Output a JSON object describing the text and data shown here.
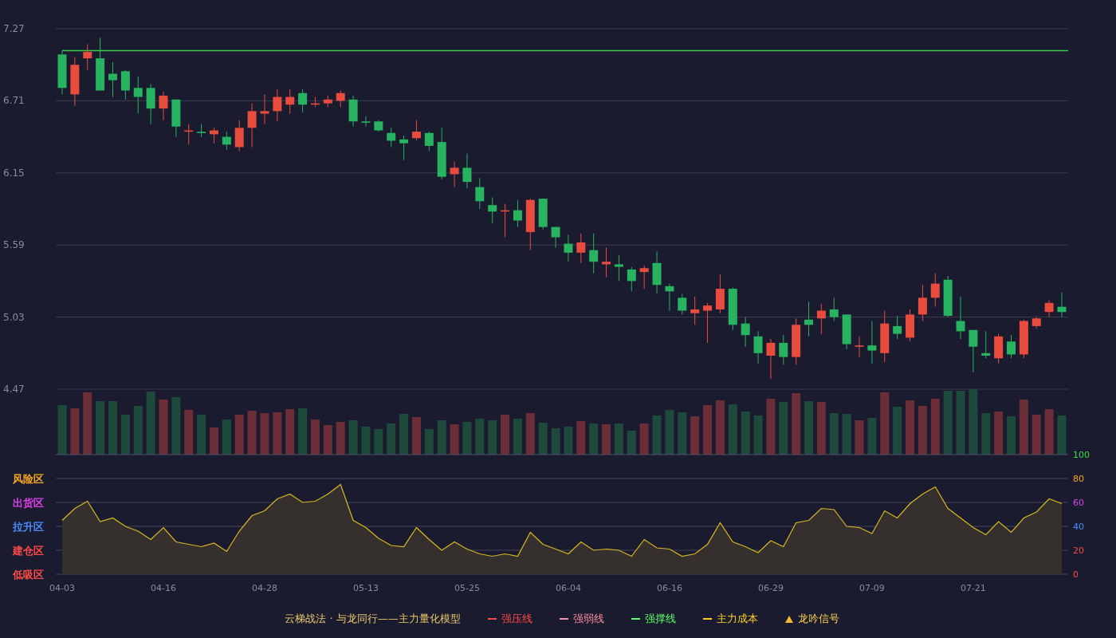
{
  "price_chart": {
    "chart_data": {
      "type": "candlestick",
      "ylim": [
        4.47,
        7.27
      ],
      "grid": true,
      "categories": [
        null,
        null,
        null,
        null,
        null,
        null,
        null,
        null,
        null,
        null,
        null,
        null,
        null,
        null,
        null,
        null,
        null,
        null,
        null,
        null,
        null,
        null,
        null,
        null,
        null,
        null,
        null,
        null,
        null,
        null,
        null,
        null,
        null,
        null,
        null,
        null,
        null,
        null,
        null,
        null,
        null,
        null,
        null,
        null,
        null,
        null,
        null,
        null,
        null,
        null,
        null,
        null,
        null,
        null,
        null,
        null,
        null,
        null,
        null,
        null,
        null,
        null,
        null,
        null,
        null,
        null,
        null,
        null,
        null,
        null,
        null,
        null,
        null,
        null,
        null,
        null,
        null,
        null,
        null,
        null
      ],
      "yticks": [
        {
          "value": 7.27,
          "label": "7.27"
        },
        {
          "value": 6.71,
          "label": "6.71"
        },
        {
          "value": 6.15,
          "label": "6.15"
        },
        {
          "value": 5.59,
          "label": "5.59"
        },
        {
          "value": 5.03,
          "label": "5.03"
        },
        {
          "value": 4.47,
          "label": "4.47"
        }
      ],
      "ohlc": [
        [
          7.07,
          7.1,
          6.76,
          6.81
        ],
        [
          6.76,
          7.05,
          6.67,
          6.99
        ],
        [
          7.04,
          7.15,
          6.95,
          7.09
        ],
        [
          7.04,
          7.2,
          6.79,
          6.79
        ],
        [
          6.92,
          7.01,
          6.74,
          6.87
        ],
        [
          6.94,
          6.95,
          6.72,
          6.79
        ],
        [
          6.81,
          6.9,
          6.61,
          6.74
        ],
        [
          6.81,
          6.84,
          6.53,
          6.65
        ],
        [
          6.65,
          6.78,
          6.56,
          6.75
        ],
        [
          6.72,
          6.72,
          6.43,
          6.51
        ],
        [
          6.47,
          6.53,
          6.37,
          6.48
        ],
        [
          6.47,
          6.53,
          6.43,
          6.46
        ],
        [
          6.45,
          6.5,
          6.38,
          6.48
        ],
        [
          6.43,
          6.47,
          6.33,
          6.37
        ],
        [
          6.35,
          6.56,
          6.32,
          6.5
        ],
        [
          6.5,
          6.69,
          6.35,
          6.63
        ],
        [
          6.61,
          6.76,
          6.53,
          6.63
        ],
        [
          6.63,
          6.8,
          6.55,
          6.74
        ],
        [
          6.68,
          6.8,
          6.61,
          6.74
        ],
        [
          6.77,
          6.8,
          6.62,
          6.68
        ],
        [
          6.68,
          6.74,
          6.66,
          6.69
        ],
        [
          6.69,
          6.75,
          6.66,
          6.72
        ],
        [
          6.71,
          6.79,
          6.66,
          6.77
        ],
        [
          6.72,
          6.75,
          6.51,
          6.55
        ],
        [
          6.55,
          6.59,
          6.51,
          6.54
        ],
        [
          6.55,
          6.56,
          6.47,
          6.48
        ],
        [
          6.46,
          6.5,
          6.35,
          6.4
        ],
        [
          6.41,
          6.44,
          6.25,
          6.38
        ],
        [
          6.42,
          6.56,
          6.4,
          6.47
        ],
        [
          6.46,
          6.47,
          6.32,
          6.36
        ],
        [
          6.39,
          6.5,
          6.1,
          6.12
        ],
        [
          6.14,
          6.24,
          6.04,
          6.19
        ],
        [
          6.19,
          6.3,
          6.03,
          6.08
        ],
        [
          6.04,
          6.11,
          5.87,
          5.93
        ],
        [
          5.9,
          5.96,
          5.76,
          5.85
        ],
        [
          5.85,
          5.91,
          5.65,
          5.86
        ],
        [
          5.86,
          5.94,
          5.73,
          5.78
        ],
        [
          5.69,
          5.95,
          5.55,
          5.94
        ],
        [
          5.95,
          5.95,
          5.71,
          5.73
        ],
        [
          5.73,
          5.73,
          5.57,
          5.65
        ],
        [
          5.6,
          5.67,
          5.46,
          5.53
        ],
        [
          5.53,
          5.68,
          5.45,
          5.61
        ],
        [
          5.55,
          5.68,
          5.37,
          5.46
        ],
        [
          5.44,
          5.57,
          5.34,
          5.46
        ],
        [
          5.44,
          5.51,
          5.31,
          5.42
        ],
        [
          5.4,
          5.42,
          5.23,
          5.31
        ],
        [
          5.38,
          5.43,
          5.25,
          5.41
        ],
        [
          5.45,
          5.54,
          5.21,
          5.28
        ],
        [
          5.27,
          5.29,
          5.08,
          5.23
        ],
        [
          5.18,
          5.21,
          5.05,
          5.08
        ],
        [
          5.06,
          5.19,
          4.97,
          5.09
        ],
        [
          5.08,
          5.14,
          4.83,
          5.12
        ],
        [
          5.09,
          5.36,
          5.06,
          5.25
        ],
        [
          5.25,
          5.26,
          4.93,
          4.97
        ],
        [
          4.98,
          5.03,
          4.8,
          4.89
        ],
        [
          4.88,
          4.92,
          4.67,
          4.75
        ],
        [
          4.73,
          4.86,
          4.55,
          4.83
        ],
        [
          4.83,
          4.89,
          4.66,
          4.72
        ],
        [
          4.72,
          5.02,
          4.66,
          4.97
        ],
        [
          5.01,
          5.15,
          4.88,
          4.97
        ],
        [
          5.02,
          5.13,
          4.9,
          5.08
        ],
        [
          5.09,
          5.18,
          5.0,
          5.03
        ],
        [
          5.05,
          5.05,
          4.78,
          4.82
        ],
        [
          4.8,
          4.88,
          4.72,
          4.81
        ],
        [
          4.81,
          5.0,
          4.67,
          4.77
        ],
        [
          4.75,
          5.08,
          4.68,
          4.98
        ],
        [
          4.96,
          5.04,
          4.86,
          4.9
        ],
        [
          4.87,
          5.09,
          4.84,
          5.05
        ],
        [
          5.05,
          5.28,
          5.0,
          5.18
        ],
        [
          5.18,
          5.37,
          5.11,
          5.29
        ],
        [
          5.32,
          5.35,
          5.03,
          5.04
        ],
        [
          5.0,
          5.19,
          4.86,
          4.92
        ],
        [
          4.93,
          4.93,
          4.6,
          4.8
        ],
        [
          4.75,
          4.92,
          4.71,
          4.73
        ],
        [
          4.71,
          4.9,
          4.67,
          4.88
        ],
        [
          4.84,
          4.89,
          4.71,
          4.74
        ],
        [
          4.74,
          5.01,
          4.71,
          5.0
        ],
        [
          4.96,
          5.03,
          4.94,
          5.02
        ],
        [
          5.07,
          5.16,
          5.03,
          5.14
        ],
        [
          5.11,
          5.22,
          5.03,
          5.07
        ]
      ],
      "ref_lines": [
        {
          "axis": "y",
          "value": 7.1,
          "color": "#3ccf4e"
        }
      ]
    }
  },
  "indicator_chart": {
    "chart_data": {
      "type": "area",
      "ylim": [
        0,
        100
      ],
      "grid": true,
      "categories": [
        "04-03",
        null,
        null,
        null,
        null,
        null,
        null,
        null,
        "04-16",
        null,
        null,
        null,
        null,
        null,
        null,
        null,
        "04-28",
        null,
        null,
        null,
        null,
        null,
        null,
        null,
        "05-13",
        null,
        null,
        null,
        null,
        null,
        null,
        null,
        "05-25",
        null,
        null,
        null,
        null,
        null,
        null,
        null,
        "06-04",
        null,
        null,
        null,
        null,
        null,
        null,
        null,
        "06-16",
        null,
        null,
        null,
        null,
        null,
        null,
        null,
        "06-29",
        null,
        null,
        null,
        null,
        null,
        null,
        null,
        "07-09",
        null,
        null,
        null,
        null,
        null,
        null,
        null,
        "07-21",
        null,
        null,
        null,
        null,
        null,
        null,
        null
      ],
      "yticks": [
        {
          "value": 100,
          "label": "100"
        },
        {
          "value": 80,
          "label": "80"
        },
        {
          "value": 60,
          "label": "60"
        },
        {
          "value": 40,
          "label": "40"
        },
        {
          "value": 20,
          "label": "20"
        },
        {
          "value": 0,
          "label": "0"
        }
      ],
      "series": [
        {
          "color": "#d8b81e",
          "values": [
            45,
            55,
            61,
            44,
            47,
            40,
            36,
            29,
            39,
            27,
            25,
            23,
            26,
            19,
            36,
            49,
            53,
            63,
            67,
            60,
            61,
            67,
            75,
            45,
            39,
            30,
            24,
            23,
            39,
            29,
            20,
            27,
            21,
            17,
            15,
            17,
            15,
            35,
            25,
            21,
            17,
            27,
            20,
            21,
            20,
            15,
            29,
            22,
            21,
            15,
            17,
            25,
            43,
            27,
            23,
            18,
            28,
            23,
            43,
            45,
            55,
            54,
            40,
            39,
            34,
            53,
            47,
            59,
            67,
            73,
            55,
            47,
            39,
            33,
            44,
            35,
            47,
            52,
            63,
            59
          ]
        }
      ]
    },
    "zones": [
      {
        "label": "风险区",
        "color": "#f5a623"
      },
      {
        "label": "出货区",
        "color": "#e040e8"
      },
      {
        "label": "拉升区",
        "color": "#4a8cff"
      },
      {
        "label": "建仓区",
        "color": "#ff4a4a"
      },
      {
        "label": "低吸区",
        "color": "#ff4a4a"
      }
    ]
  },
  "legend": {
    "title": "云梯战法 · 与龙同行——主力量化模型",
    "items": [
      {
        "label": "强压线",
        "kind": "solid",
        "color": "#ff4a4a"
      },
      {
        "label": "强弱线",
        "kind": "dashed",
        "color": "#ff8fa3"
      },
      {
        "label": "强撑线",
        "kind": "solid",
        "color": "#5cff6a"
      },
      {
        "label": "主力成本",
        "kind": "dashed",
        "color": "#ffd21f"
      },
      {
        "label": "龙吟信号",
        "kind": "triangle",
        "color": "#f5b82e"
      }
    ]
  }
}
